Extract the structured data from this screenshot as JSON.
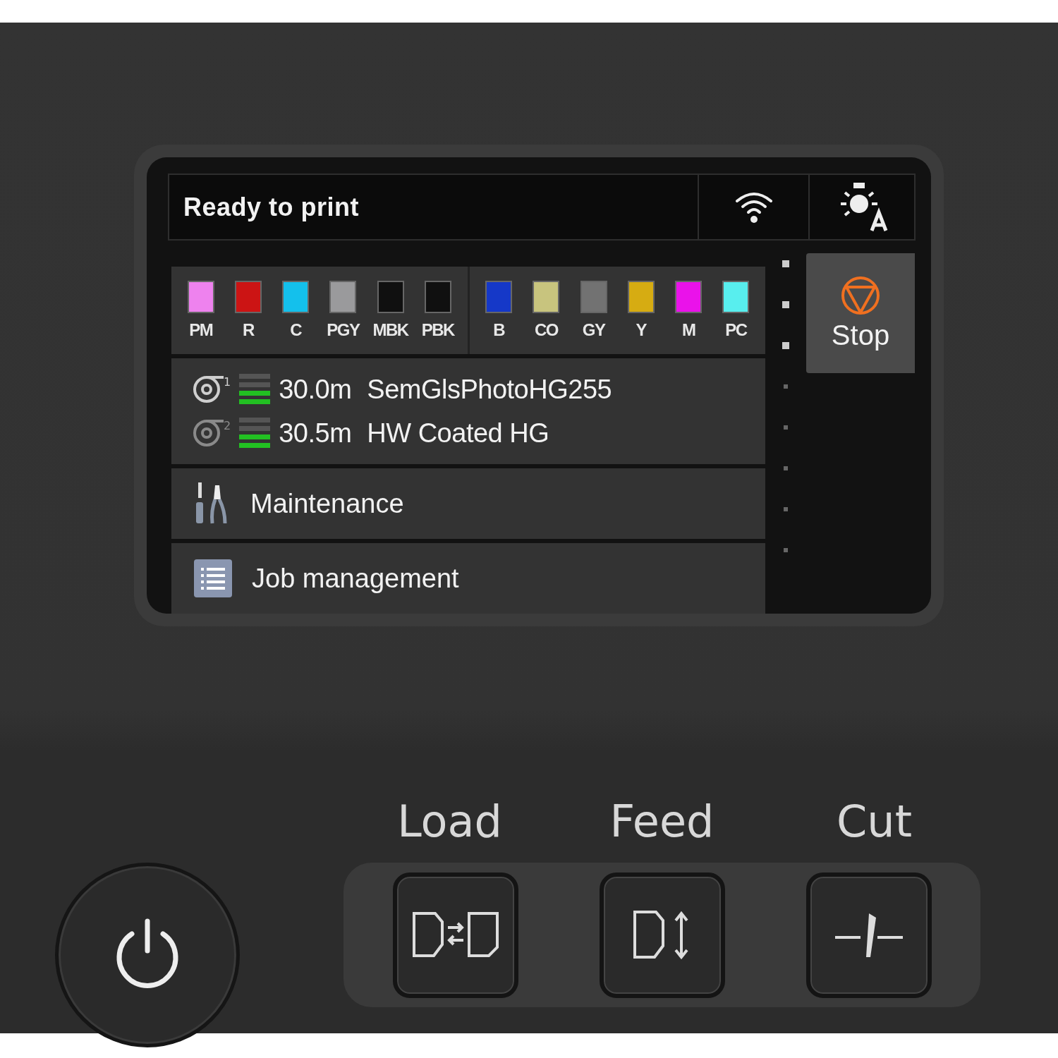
{
  "status": {
    "title": "Ready to print"
  },
  "inks": [
    {
      "label": "PM",
      "color": "#ee82ee"
    },
    {
      "label": "R",
      "color": "#cc1414"
    },
    {
      "label": "C",
      "color": "#14c0ec"
    },
    {
      "label": "PGY",
      "color": "#9a9a9c"
    },
    {
      "label": "MBK",
      "color": "#101010"
    },
    {
      "label": "PBK",
      "color": "#101010"
    },
    {
      "label": "B",
      "color": "#1538c8"
    },
    {
      "label": "CO",
      "color": "#c8c47e"
    },
    {
      "label": "GY",
      "color": "#727272"
    },
    {
      "label": "Y",
      "color": "#d6ac12"
    },
    {
      "label": "M",
      "color": "#ea12ea"
    },
    {
      "label": "PC",
      "color": "#58eeee"
    }
  ],
  "rolls": [
    {
      "number": "1",
      "selected": true,
      "level": 0.5,
      "length": "30.0m",
      "media": "SemGlsPhotoHG255"
    },
    {
      "number": "2",
      "selected": false,
      "level": 0.5,
      "length": "30.5m",
      "media": "HW Coated HG"
    }
  ],
  "menu": [
    {
      "kind": "maintenance",
      "label": "Maintenance"
    },
    {
      "kind": "jobs",
      "label": "Job management"
    }
  ],
  "stop_button": {
    "label": "Stop"
  },
  "hard_buttons": [
    {
      "kind": "load",
      "label": "Load"
    },
    {
      "kind": "feed",
      "label": "Feed"
    },
    {
      "kind": "cut",
      "label": "Cut"
    }
  ]
}
